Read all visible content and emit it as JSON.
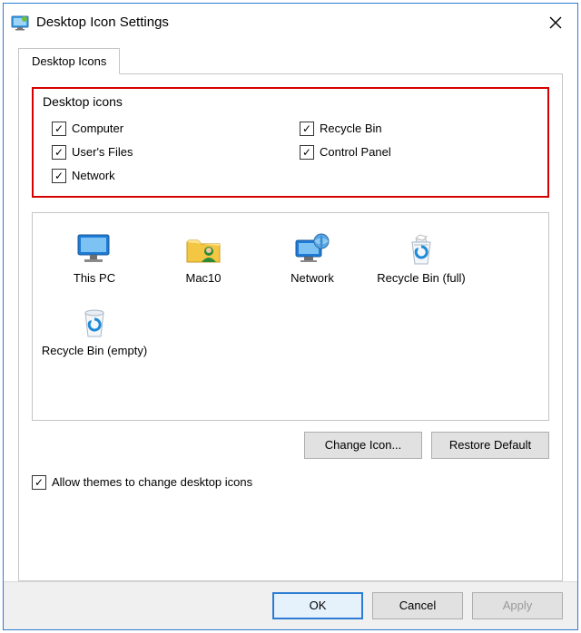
{
  "window": {
    "title": "Desktop Icon Settings"
  },
  "tab": {
    "label": "Desktop Icons"
  },
  "group": {
    "title": "Desktop icons",
    "left": [
      {
        "label": "Computer",
        "checked": true
      },
      {
        "label": "User's Files",
        "checked": true
      },
      {
        "label": "Network",
        "checked": true
      }
    ],
    "right": [
      {
        "label": "Recycle Bin",
        "checked": true
      },
      {
        "label": "Control Panel",
        "checked": true
      }
    ]
  },
  "icons": [
    {
      "name": "This PC",
      "glyph": "thispc"
    },
    {
      "name": "Mac10",
      "glyph": "userfolder"
    },
    {
      "name": "Network",
      "glyph": "network"
    },
    {
      "name": "Recycle Bin (full)",
      "glyph": "bin-full"
    },
    {
      "name": "Recycle Bin (empty)",
      "glyph": "bin-empty"
    }
  ],
  "buttons": {
    "change_icon": "Change Icon...",
    "restore_default": "Restore Default",
    "ok": "OK",
    "cancel": "Cancel",
    "apply": "Apply"
  },
  "allow_themes": {
    "label": "Allow themes to change desktop icons",
    "checked": true
  }
}
